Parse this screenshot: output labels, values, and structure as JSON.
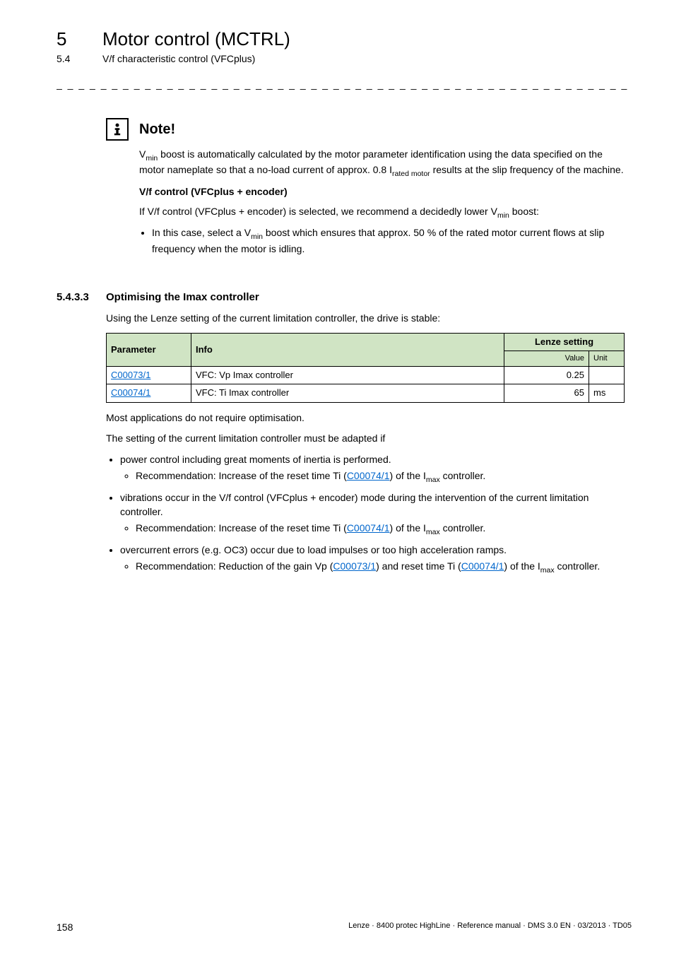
{
  "header": {
    "chapter_num": "5",
    "chapter_title": "Motor control (MCTRL)",
    "sub_num": "5.4",
    "sub_title": "V/f characteristic control (VFCplus)"
  },
  "note": {
    "label": "Note!",
    "p1_pre": "V",
    "p1_sub1": "min",
    "p1_mid": " boost is automatically calculated by the motor parameter identification using the data specified on the motor nameplate so that a no-load current of approx. 0.8 I",
    "p1_sub2": "rated motor",
    "p1_post": " results at the slip frequency of the machine.",
    "p2": "V/f control (VFCplus + encoder)",
    "p3_pre": "If V/f control (VFCplus + encoder) is selected, we recommend a decidedly lower V",
    "p3_sub": "min",
    "p3_post": " boost:",
    "b1_pre": "In this case, select a V",
    "b1_sub": "min",
    "b1_post": " boost which ensures that approx. 50 % of the rated motor current flows at slip frequency when the motor is idling."
  },
  "section": {
    "num": "5.4.3.3",
    "title": "Optimising the Imax controller",
    "intro": "Using the Lenze setting of the current limitation controller, the drive is stable:",
    "th_parameter": "Parameter",
    "th_info": "Info",
    "th_lenze": "Lenze setting",
    "th_value": "Value",
    "th_unit": "Unit",
    "rows": [
      {
        "param": "C00073/1",
        "info": "VFC: Vp Imax controller",
        "value": "0.25",
        "unit": ""
      },
      {
        "param": "C00074/1",
        "info": "VFC: Ti Imax controller",
        "value": "65",
        "unit": "ms"
      }
    ],
    "after1": "Most applications do not require optimisation.",
    "after2": "The setting of the current limitation controller must be adapted if",
    "bullets": {
      "b1": "power control including great moments of inertia is performed.",
      "b1_sub_pre": "Recommendation: Increase of the reset time Ti (",
      "b1_sub_link": "C00074/1",
      "b1_sub_mid": ") of the I",
      "b1_sub_subscript": "max",
      "b1_sub_post": " controller.",
      "b2": "vibrations occur in the V/f control (VFCplus + encoder) mode during the intervention of the current limitation controller.",
      "b2_sub_pre": "Recommendation: Increase of the reset time Ti (",
      "b2_sub_link": "C00074/1",
      "b2_sub_mid": ") of the I",
      "b2_sub_subscript": "max",
      "b2_sub_post": " controller.",
      "b3": "overcurrent errors (e.g. OC3) occur due to load impulses or too high acceleration ramps.",
      "b3_sub_pre": "Recommendation: Reduction of the gain Vp (",
      "b3_sub_link1": "C00073/1",
      "b3_sub_mid1": ") and reset time Ti (",
      "b3_sub_link2": "C00074/1",
      "b3_sub_mid2": ") of the I",
      "b3_sub_subscript": "max",
      "b3_sub_post": " controller."
    }
  },
  "footer": {
    "page": "158",
    "text": "Lenze · 8400 protec HighLine · Reference manual · DMS 3.0 EN · 03/2013 · TD05"
  },
  "dash_line": "_ _ _ _ _ _ _ _ _ _ _ _ _ _ _ _ _ _ _ _ _ _ _ _ _ _ _ _ _ _ _ _ _ _ _ _ _ _ _ _ _ _ _ _ _ _ _ _ _ _ _ _ _ _ _ _ _ _ _ _ _ _ _ _"
}
